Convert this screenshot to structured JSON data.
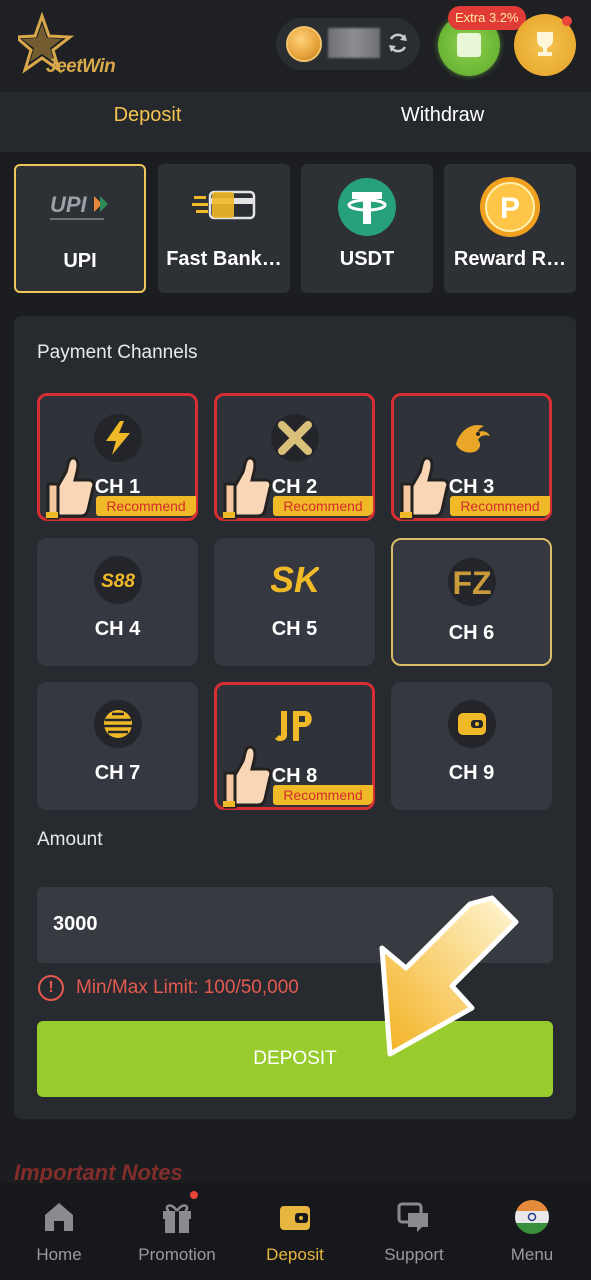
{
  "header": {
    "logo_text": "JeetWin",
    "extra_badge": "Extra 3.2%"
  },
  "tabs": [
    {
      "label": "Deposit",
      "active": true
    },
    {
      "label": "Withdraw",
      "active": false
    }
  ],
  "methods": [
    {
      "label": "UPI",
      "icon": "upi-logo",
      "active": true
    },
    {
      "label": "Fast Bank Transfer",
      "display": "Fast Bank…",
      "icon": "bank-card-icon"
    },
    {
      "label": "USDT",
      "display": "USDT",
      "icon": "tether-icon"
    },
    {
      "label": "Reward Redeem",
      "display": "Reward R…",
      "icon": "reward-coin-icon"
    }
  ],
  "payment_channels": {
    "title": "Payment Channels",
    "recommend_label": "Recommend",
    "channels": [
      {
        "name": "CH 1",
        "icon": "lightning-icon",
        "recommended": true
      },
      {
        "name": "CH 2",
        "icon": "x-icon",
        "recommended": true
      },
      {
        "name": "CH 3",
        "icon": "dragon-icon",
        "recommended": true
      },
      {
        "name": "CH 4",
        "icon": "s88-icon",
        "recommended": false
      },
      {
        "name": "CH 5",
        "icon": "sk-icon",
        "recommended": false
      },
      {
        "name": "CH 6",
        "icon": "fz-icon",
        "recommended": false,
        "selected": true
      },
      {
        "name": "CH 7",
        "icon": "globe-icon",
        "recommended": false
      },
      {
        "name": "CH 8",
        "icon": "jp-icon",
        "recommended": true
      },
      {
        "name": "CH 9",
        "icon": "wallet-icon",
        "recommended": false
      }
    ]
  },
  "amount": {
    "label": "Amount",
    "value": "3000",
    "limit_text": "Min/Max Limit: 100/50,000"
  },
  "deposit_button": "DEPOSIT",
  "notes_title": "Important Notes",
  "bottom_nav": [
    {
      "label": "Home",
      "icon": "home-icon"
    },
    {
      "label": "Promotion",
      "icon": "gift-icon"
    },
    {
      "label": "Deposit",
      "icon": "wallet-icon",
      "active": true
    },
    {
      "label": "Support",
      "icon": "chat-icon"
    },
    {
      "label": "Menu",
      "icon": "india-flag-icon"
    }
  ],
  "colors": {
    "accent": "#f4c350",
    "recommend_border": "#d52f34",
    "deposit_button": "#97cb2e",
    "error": "#e55a4f"
  }
}
